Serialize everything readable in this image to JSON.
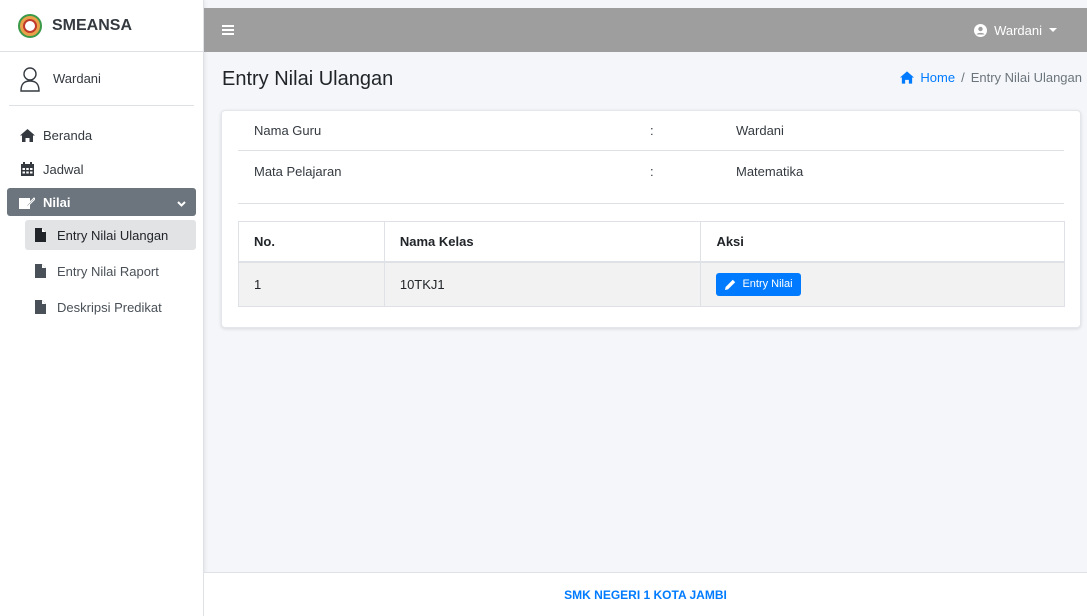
{
  "brand": {
    "name": "SMEANSA"
  },
  "sidebar_user": {
    "name": "Wardani"
  },
  "nav": {
    "beranda": "Beranda",
    "jadwal": "Jadwal",
    "nilai": "Nilai",
    "sub": [
      "Entry Nilai Ulangan",
      "Entry Nilai Raport",
      "Deskripsi Predikat"
    ]
  },
  "topbar": {
    "user": "Wardani"
  },
  "page": {
    "title": "Entry Nilai Ulangan"
  },
  "breadcrumb": {
    "home": "Home",
    "separator": "/",
    "current": "Entry Nilai Ulangan"
  },
  "info": {
    "guru_label": "Nama Guru",
    "guru_value": "Wardani",
    "mapel_label": "Mata Pelajaran",
    "mapel_value": "Matematika",
    "colon": ":"
  },
  "table": {
    "headers": [
      "No.",
      "Nama Kelas",
      "Aksi"
    ],
    "rows": [
      {
        "no": "1",
        "kelas": "10TKJ1",
        "action": "Entry Nilai"
      }
    ]
  },
  "footer": {
    "text": "SMK NEGERI 1 KOTA JAMBI"
  },
  "colors": {
    "accent": "#007bff",
    "topbar": "#9e9e9e",
    "active_nav": "#6c757d"
  }
}
